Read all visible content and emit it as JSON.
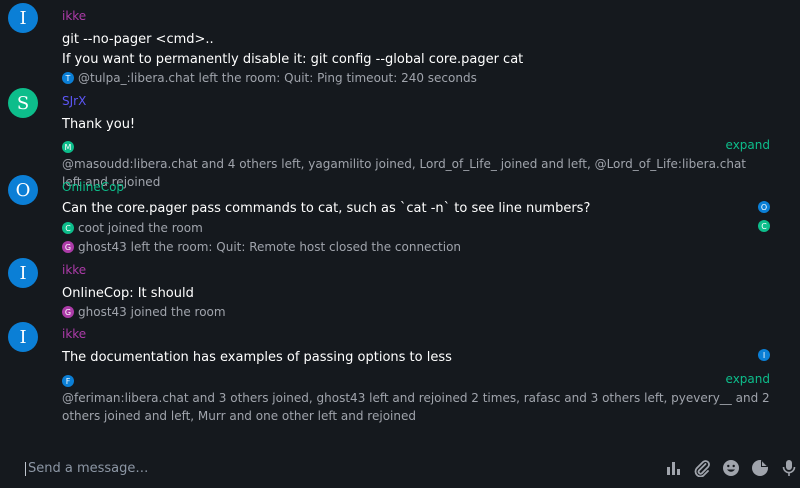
{
  "colors": {
    "ikke": "#ac3ba8",
    "sjrx": "#5c56f5",
    "onlinecop": "#0dbd8b",
    "accent": "#0dbd8b"
  },
  "timeline": {
    "g1": {
      "avatar_letter": "I",
      "sender": "ikke",
      "msg1": "git --no-pager <cmd>..",
      "msg2": "If you want to permanently disable it: git config --global core.pager cat",
      "event": {
        "avatar": "T",
        "text": "@tulpa_:libera.chat left the room: Quit: Ping timeout: 240 seconds"
      }
    },
    "g2": {
      "avatar_letter": "S",
      "sender": "SJrX",
      "msg1": "Thank you!",
      "summary_avatar": "M",
      "expand": "expand",
      "summary": "@masoudd:libera.chat and 4 others left, yagamilito joined, Lord_of_Life_ joined and left, @Lord_of_Life:libera.chat left and rejoined"
    },
    "g3": {
      "avatar_letter": "O",
      "sender": "OnlineCop",
      "msg1": "Can the core.pager pass commands to cat, such as `cat -n` to see line numbers?",
      "receipt1": "O",
      "receipt2": "C",
      "event1": {
        "avatar": "C",
        "text": "coot joined the room"
      },
      "event2": {
        "avatar": "G",
        "text": "ghost43 left the room: Quit: Remote host closed the connection"
      }
    },
    "g4": {
      "avatar_letter": "I",
      "sender": "ikke",
      "msg1": "OnlineCop: It should",
      "event": {
        "avatar": "G",
        "text": "ghost43 joined the room"
      }
    },
    "g5": {
      "avatar_letter": "I",
      "sender": "ikke",
      "msg1": "The documentation has examples of passing options to less",
      "receipt": "I",
      "summary_avatar": "F",
      "expand": "expand",
      "summary": "@feriman:libera.chat and 3 others joined, ghost43 left and rejoined 2 times, rafasc and 3 others left, pyevery__ and 2 others joined and left, Murr and one other left and rejoined"
    }
  },
  "composer": {
    "placeholder": "Send a message…",
    "icons": [
      "poll-icon",
      "attachment-icon",
      "emoji-icon",
      "sticker-icon",
      "microphone-icon"
    ]
  }
}
